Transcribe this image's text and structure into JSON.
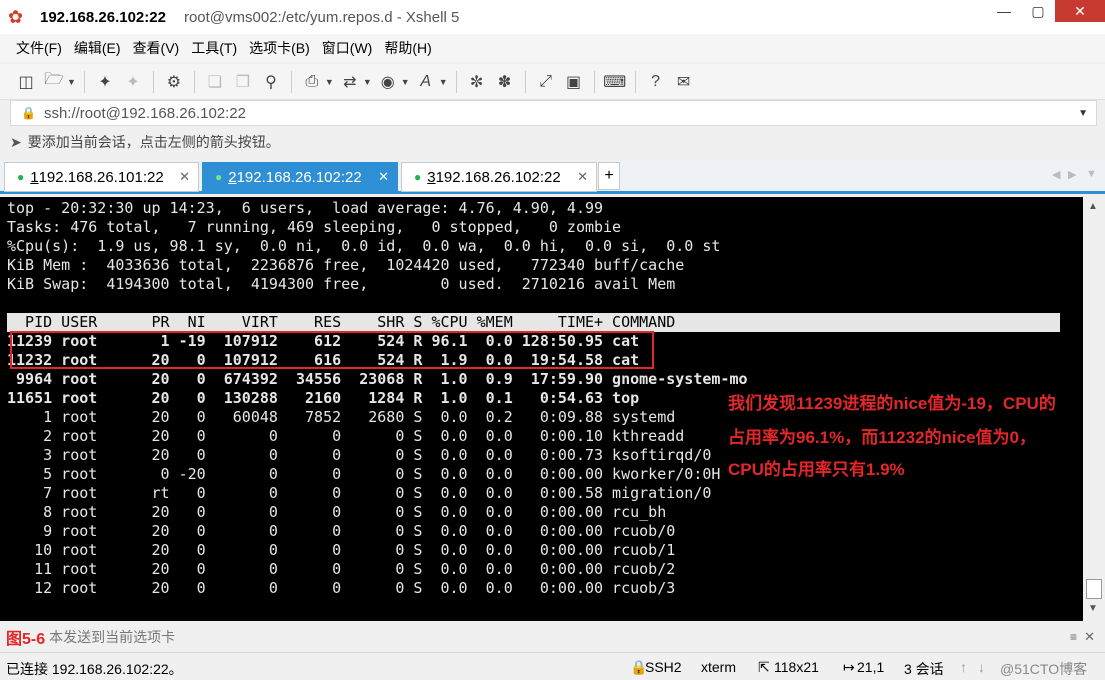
{
  "window": {
    "ip": "192.168.26.102:22",
    "path": "root@vms002:/etc/yum.repos.d - Xshell 5",
    "minimize": "—",
    "maximize": "▢",
    "close": "✕"
  },
  "menu": [
    "文件(F)",
    "编辑(E)",
    "查看(V)",
    "工具(T)",
    "选项卡(B)",
    "窗口(W)",
    "帮助(H)"
  ],
  "address": "ssh://root@192.168.26.102:22",
  "hint": "要添加当前会话，点击左侧的箭头按钮。",
  "tabs": [
    {
      "num": "1",
      "label": " 192.168.26.101:22"
    },
    {
      "num": "2",
      "label": " 192.168.26.102:22"
    },
    {
      "num": "3",
      "label": " 192.168.26.102:22"
    }
  ],
  "terminal": {
    "lines": [
      "top - 20:32:30 up 14:23,  6 users,  load average: 4.76, 4.90, 4.99",
      "Tasks: 476 total,   7 running, 469 sleeping,   0 stopped,   0 zombie",
      "%Cpu(s):  1.9 us, 98.1 sy,  0.0 ni,  0.0 id,  0.0 wa,  0.0 hi,  0.0 si,  0.0 st",
      "KiB Mem :  4033636 total,  2236876 free,  1024420 used,   772340 buff/cache",
      "KiB Swap:  4194300 total,  4194300 free,        0 used.  2710216 avail Mem"
    ],
    "header": "  PID USER      PR  NI    VIRT    RES    SHR S %CPU %MEM     TIME+ COMMAND",
    "rows": [
      "11239 root       1 -19  107912    612    524 R 96.1  0.0 128:50.95 cat",
      "11232 root      20   0  107912    616    524 R  1.9  0.0  19:54.58 cat",
      " 9964 root      20   0  674392  34556  23068 R  1.0  0.9  17:59.90 gnome-system-mo",
      "11651 root      20   0  130288   2160   1284 R  1.0  0.1   0:54.63 top",
      "    1 root      20   0   60048   7852   2680 S  0.0  0.2   0:09.88 systemd",
      "    2 root      20   0       0      0      0 S  0.0  0.0   0:00.10 kthreadd",
      "    3 root      20   0       0      0      0 S  0.0  0.0   0:00.73 ksoftirqd/0",
      "    5 root       0 -20       0      0      0 S  0.0  0.0   0:00.00 kworker/0:0H",
      "    7 root      rt   0       0      0      0 S  0.0  0.0   0:00.58 migration/0",
      "    8 root      20   0       0      0      0 S  0.0  0.0   0:00.00 rcu_bh",
      "    9 root      20   0       0      0      0 S  0.0  0.0   0:00.00 rcuob/0",
      "   10 root      20   0       0      0      0 S  0.0  0.0   0:00.00 rcuob/1",
      "   11 root      20   0       0      0      0 S  0.0  0.0   0:00.00 rcuob/2",
      "   12 root      20   0       0      0      0 S  0.0  0.0   0:00.00 rcuob/3"
    ]
  },
  "annotation": [
    "我们发现11239进程的nice值为-19，CPU的",
    "占用率为96.1%，而11232的nice值为0，",
    "CPU的占用率只有1.9%"
  ],
  "send_bar": {
    "figure_label": "图5-6",
    "text": "本发送到当前选项卡"
  },
  "status": {
    "connected": "已连接 192.168.26.102:22。",
    "protocol": "SSH2",
    "term": "xterm",
    "size": "118x21",
    "cursor": "21,1",
    "sessions": "3 会话",
    "watermark": "@51CTO博客"
  },
  "colors": {
    "accent": "#2f8fd4",
    "annotation": "#e2272b",
    "close_button": "#c73a2f"
  }
}
